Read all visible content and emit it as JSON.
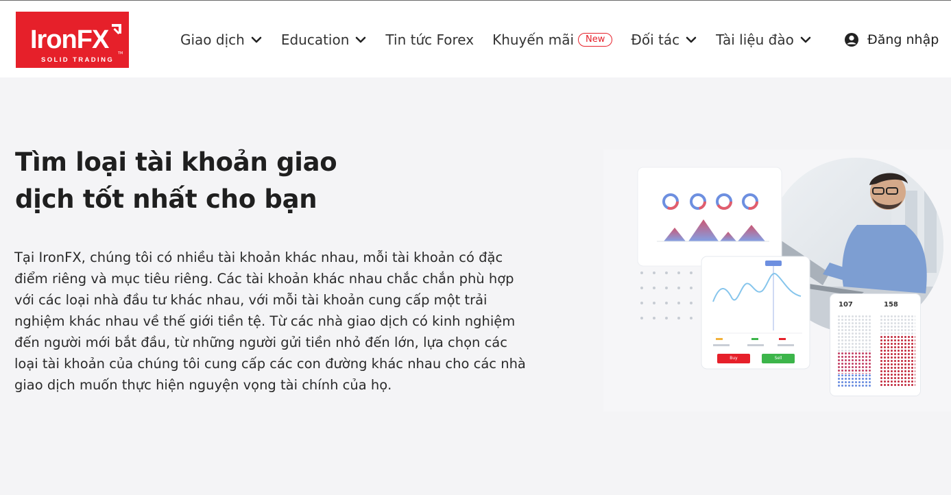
{
  "brand": {
    "name": "IronFX",
    "tagline": "SOLID TRADING",
    "color": "#e6202a"
  },
  "nav": {
    "items": [
      {
        "label": "Giao dịch",
        "dropdown": true
      },
      {
        "label": "Education",
        "dropdown": true
      },
      {
        "label": "Tin tức Forex",
        "dropdown": false
      },
      {
        "label": "Khuyến mãi",
        "badge": "New",
        "dropdown": false
      },
      {
        "label": "Đối tác",
        "dropdown": true
      },
      {
        "label": "Tài liệu đào",
        "dropdown": true
      }
    ],
    "login_label": "Đăng nhập"
  },
  "hero": {
    "title_line1": "Tìm loại tài khoản giao",
    "title_line2": "dịch tốt nhất cho bạn",
    "body": "Tại IronFX, chúng tôi có nhiều tài khoản khác nhau, mỗi tài khoản có đặc điểm riêng và mục tiêu riêng. Các tài khoản khác nhau chắc chắn phù hợp với các loại nhà đầu tư khác nhau, với mỗi tài khoản cung cấp một trải nghiệm khác nhau về thế giới tiền tệ. Từ các nhà giao dịch có kinh nghiệm đến người mới bắt đầu, từ những người gửi tiền nhỏ đến lớn, lựa chọn các loại tài khoản của chúng tôi cung cấp các con đường khác nhau cho các nhà giao dịch muốn thực hiện nguyện vọng tài chính của họ."
  },
  "illustration": {
    "counter_left": "107",
    "counter_right": "158",
    "buy_label": "Buy",
    "sell_label": "Sell"
  }
}
